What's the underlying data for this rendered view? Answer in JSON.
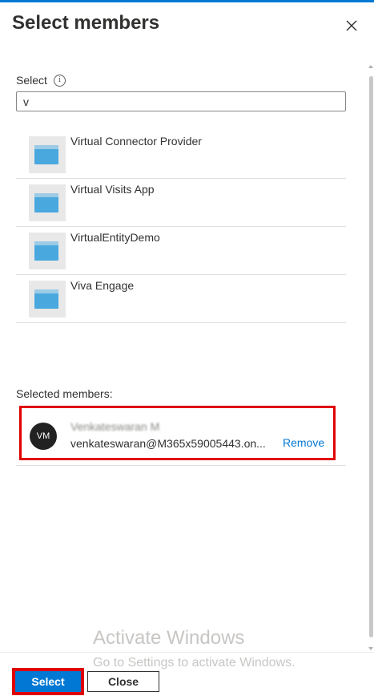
{
  "panel": {
    "title": "Select members",
    "close_icon": "close-icon"
  },
  "search": {
    "label": "Select",
    "info_icon": "info-icon",
    "info_glyph": "i",
    "value": "v"
  },
  "results": [
    {
      "name": "Virtual Connector Provider",
      "icon": "app-window-icon"
    },
    {
      "name": "Virtual Visits App",
      "icon": "app-window-icon"
    },
    {
      "name": "VirtualEntityDemo",
      "icon": "app-window-icon"
    },
    {
      "name": "Viva Engage",
      "icon": "app-window-icon"
    }
  ],
  "selected": {
    "label": "Selected members:",
    "members": [
      {
        "initials": "VM",
        "name": "Venkateswaran M",
        "email": "venkateswaran@M365x59005443.on...",
        "remove_label": "Remove"
      }
    ]
  },
  "watermark": {
    "title": "Activate Windows",
    "subtitle": "Go to Settings to activate Windows."
  },
  "footer": {
    "select_label": "Select",
    "close_label": "Close"
  },
  "colors": {
    "accent": "#0078d4",
    "highlight": "#e00000"
  }
}
